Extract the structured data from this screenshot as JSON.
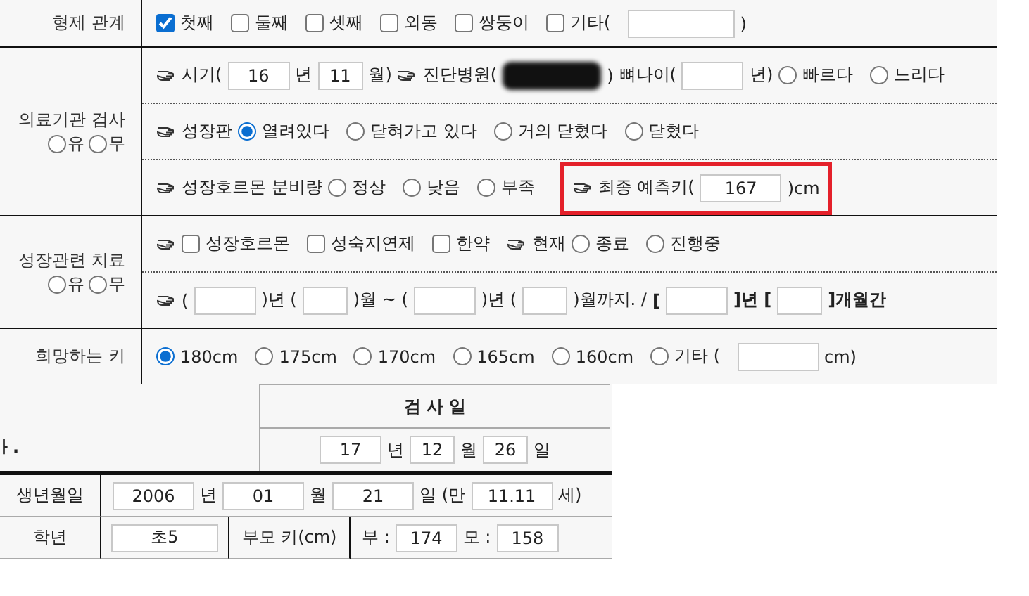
{
  "upper_form": {
    "rows": [
      {
        "label": {
          "title": "형제 관계"
        },
        "subrows": [
          [
            {
              "kind": "checkbox",
              "label": "첫째",
              "checked": true
            },
            {
              "kind": "checkbox",
              "label": "둘째",
              "checked": false
            },
            {
              "kind": "checkbox",
              "label": "셋째",
              "checked": false
            },
            {
              "kind": "checkbox",
              "label": "외동",
              "checked": false
            },
            {
              "kind": "checkbox",
              "label": "쌍둥이",
              "checked": false
            },
            {
              "kind": "checkbox",
              "label": "기타(",
              "checked": false
            },
            {
              "kind": "field"
            },
            {
              "kind": "text",
              "text": ")"
            }
          ]
        ]
      },
      {
        "label": {
          "title": "의료기관 검사",
          "choices": [
            {
              "label": "유",
              "selected": false
            },
            {
              "label": "무",
              "selected": false
            }
          ]
        },
        "subrows": [
          [
            {
              "kind": "pointer"
            },
            {
              "kind": "text",
              "text": "시기("
            },
            {
              "kind": "field",
              "value": "16"
            },
            {
              "kind": "text",
              "text": "년"
            },
            {
              "kind": "field",
              "value": "11"
            },
            {
              "kind": "text",
              "text": "월)"
            },
            {
              "kind": "pointer"
            },
            {
              "kind": "text",
              "text": "진단병원("
            },
            {
              "kind": "redacted"
            },
            {
              "kind": "text",
              "text": ")"
            },
            {
              "kind": "text",
              "text": "뼈나이("
            },
            {
              "kind": "field"
            },
            {
              "kind": "text",
              "text": "년)"
            },
            {
              "kind": "radio",
              "label": "빠르다",
              "selected": false
            },
            {
              "kind": "radio",
              "label": "느리다",
              "selected": false
            }
          ],
          [
            {
              "kind": "pointer"
            },
            {
              "kind": "text",
              "text": "성장판"
            },
            {
              "kind": "radio",
              "label": "열려있다",
              "selected": true
            },
            {
              "kind": "radio",
              "label": "닫혀가고 있다",
              "selected": false
            },
            {
              "kind": "radio",
              "label": "거의 닫혔다",
              "selected": false
            },
            {
              "kind": "radio",
              "label": "닫혔다",
              "selected": false
            }
          ],
          [
            {
              "kind": "pointer"
            },
            {
              "kind": "text",
              "text": "성장호르몬 분비량"
            },
            {
              "kind": "radio",
              "label": "정상",
              "selected": false
            },
            {
              "kind": "radio",
              "label": "낮음",
              "selected": false
            },
            {
              "kind": "radio",
              "label": "부족",
              "selected": false
            },
            {
              "kind": "group",
              "highlighted": true,
              "items": [
                {
                  "kind": "pointer"
                },
                {
                  "kind": "text",
                  "text": "최종 예측키("
                },
                {
                  "kind": "field",
                  "value": "167"
                },
                {
                  "kind": "text",
                  "text": ")cm"
                }
              ]
            }
          ]
        ]
      },
      {
        "label": {
          "title": "성장관련 치료",
          "choices": [
            {
              "label": "유",
              "selected": false
            },
            {
              "label": "무",
              "selected": false
            }
          ]
        },
        "subrows": [
          [
            {
              "kind": "pointer"
            },
            {
              "kind": "checkbox",
              "label": "성장호르몬",
              "checked": false
            },
            {
              "kind": "checkbox",
              "label": "성숙지연제",
              "checked": false
            },
            {
              "kind": "checkbox",
              "label": "한약",
              "checked": false
            },
            {
              "kind": "pointer"
            },
            {
              "kind": "text",
              "text": "현재"
            },
            {
              "kind": "radio",
              "label": "종료",
              "selected": false
            },
            {
              "kind": "radio",
              "label": "진행중",
              "selected": false
            }
          ],
          [
            {
              "kind": "pointer"
            },
            {
              "kind": "text",
              "text": "("
            },
            {
              "kind": "field"
            },
            {
              "kind": "text",
              "text": ")년 ("
            },
            {
              "kind": "field"
            },
            {
              "kind": "text",
              "text": ")월 ~ ("
            },
            {
              "kind": "field"
            },
            {
              "kind": "text",
              "text": ")년 ("
            },
            {
              "kind": "field"
            },
            {
              "kind": "text",
              "text": ")월까지. /"
            },
            {
              "kind": "bold_text",
              "text": "["
            },
            {
              "kind": "field"
            },
            {
              "kind": "bold_text",
              "text": "]년 ["
            },
            {
              "kind": "field"
            },
            {
              "kind": "bold_text",
              "text": "]개월간"
            }
          ]
        ]
      },
      {
        "label": {
          "title": "희망하는 키"
        },
        "subrows": [
          [
            {
              "kind": "radio",
              "label": "180cm",
              "selected": true
            },
            {
              "kind": "radio",
              "label": "175cm",
              "selected": false
            },
            {
              "kind": "radio",
              "label": "170cm",
              "selected": false
            },
            {
              "kind": "radio",
              "label": "165cm",
              "selected": false
            },
            {
              "kind": "radio",
              "label": "160cm",
              "selected": false
            },
            {
              "kind": "radio",
              "label": "기타 (",
              "selected": false
            },
            {
              "kind": "field"
            },
            {
              "kind": "text",
              "text": "cm)"
            }
          ]
        ]
      }
    ]
  },
  "lower_form": {
    "note_fragment": "ㅏ.",
    "exam_date": {
      "title": "검 사 일",
      "items": [
        {
          "kind": "field",
          "value": "17"
        },
        {
          "kind": "text",
          "text": "년"
        },
        {
          "kind": "field",
          "value": "12"
        },
        {
          "kind": "text",
          "text": "월"
        },
        {
          "kind": "field",
          "value": "26"
        },
        {
          "kind": "text",
          "text": "일"
        }
      ]
    },
    "birth": {
      "label": "생년월일",
      "items": [
        {
          "kind": "field",
          "value": "2006"
        },
        {
          "kind": "text",
          "text": "년"
        },
        {
          "kind": "field",
          "value": "01"
        },
        {
          "kind": "text",
          "text": "월"
        },
        {
          "kind": "field",
          "value": "21"
        },
        {
          "kind": "text",
          "text": "일 (만"
        },
        {
          "kind": "field",
          "value": "11.11"
        },
        {
          "kind": "text",
          "text": "세)"
        }
      ]
    },
    "grade": {
      "label": "학년",
      "value": "초5",
      "parents_label": "부모 키(cm)",
      "items": [
        {
          "kind": "text",
          "text": "부 :"
        },
        {
          "kind": "field",
          "value": "174"
        },
        {
          "kind": "text",
          "text": "모 :"
        },
        {
          "kind": "field",
          "value": "158"
        }
      ]
    }
  }
}
